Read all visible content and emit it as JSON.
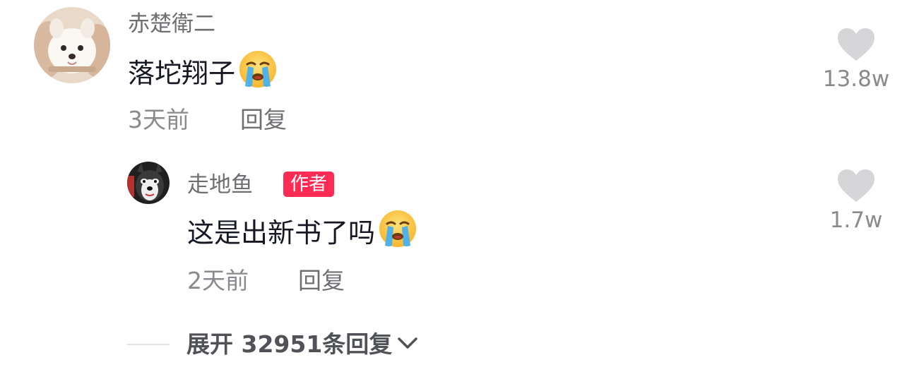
{
  "comment": {
    "username": "赤楚衛二",
    "text": "落坨翔子",
    "emoji": "loudly-crying-face",
    "time": "3天前",
    "reply_label": "回复",
    "likes": "13.8w",
    "avatar": "white-puppy-avatar"
  },
  "reply": {
    "username": "走地鱼",
    "badge": "作者",
    "text": "这是出新书了吗",
    "emoji": "loudly-crying-face",
    "time": "2天前",
    "reply_label": "回复",
    "likes": "1.7w",
    "avatar": "husky-dog-avatar"
  },
  "expand": {
    "label": "展开 32951条回复"
  },
  "colors": {
    "badge_bg": "#fe2c55",
    "heart": "#d6d6d8",
    "text_primary": "#161823",
    "text_secondary": "#8a8a8e"
  }
}
